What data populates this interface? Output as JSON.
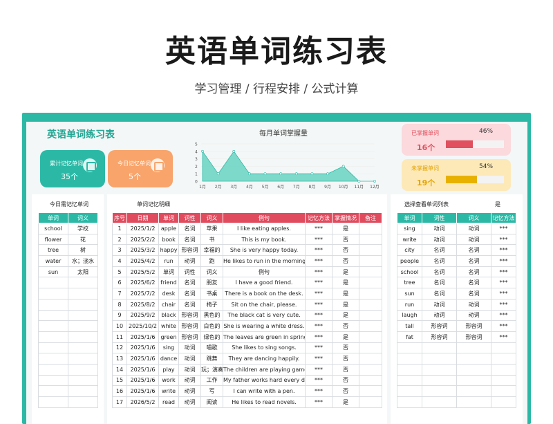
{
  "hero": {
    "title": "英语单词练习表",
    "subtitle": "学习管理 / 行程安排 / 公式计算"
  },
  "app_title": "英语单词练习表",
  "kpis": [
    {
      "label": "累计记忆单词",
      "value": "35个"
    },
    {
      "label": "今日记忆单词",
      "value": "5个"
    }
  ],
  "chart_data": {
    "type": "area",
    "title": "每月单词掌握量",
    "categories": [
      "1月",
      "2月",
      "3月",
      "4月",
      "5月",
      "6月",
      "7月",
      "8月",
      "9月",
      "10月",
      "11月",
      "12月"
    ],
    "values": [
      4,
      1,
      4,
      1,
      1,
      1,
      1,
      1,
      1,
      2,
      0,
      0
    ],
    "yticks": [
      "0",
      "1",
      "2",
      "3",
      "4",
      "5"
    ],
    "ylim": [
      0,
      5
    ],
    "colors": {
      "fill": "#67d4c2",
      "line": "#2bb9a6"
    }
  },
  "stats": [
    {
      "label": "已掌握单词",
      "value": "16个",
      "pct_text": "46%",
      "pct": 46
    },
    {
      "label": "未掌握单词",
      "value": "19个",
      "pct_text": "54%",
      "pct": 54
    }
  ],
  "today": {
    "title": "今日需记忆单词",
    "headers": [
      "单词",
      "词义"
    ],
    "rows": [
      [
        "school",
        "学校"
      ],
      [
        "flower",
        "花"
      ],
      [
        "tree",
        "树"
      ],
      [
        "water",
        "水；浇水"
      ],
      [
        "sun",
        "太阳"
      ],
      [
        "",
        ""
      ],
      [
        "",
        ""
      ],
      [
        "",
        ""
      ],
      [
        "",
        ""
      ],
      [
        "",
        ""
      ],
      [
        "",
        ""
      ],
      [
        "",
        ""
      ],
      [
        "",
        ""
      ],
      [
        "",
        ""
      ],
      [
        "",
        ""
      ],
      [
        "",
        ""
      ],
      [
        "",
        ""
      ]
    ]
  },
  "detail": {
    "title": "单词记忆明细",
    "headers": [
      "序号",
      "日期",
      "单词",
      "词性",
      "词义",
      "例句",
      "记忆方法",
      "掌握情况",
      "备注"
    ],
    "rows": [
      [
        "1",
        "2025/1/2",
        "apple",
        "名词",
        "苹果",
        "I like eating apples.",
        "***",
        "是",
        ""
      ],
      [
        "2",
        "2025/2/2",
        "book",
        "名词",
        "书",
        "This is my book.",
        "***",
        "否",
        ""
      ],
      [
        "3",
        "2025/3/2",
        "happy",
        "形容词",
        "幸福的",
        "She is very happy today.",
        "***",
        "否",
        ""
      ],
      [
        "4",
        "2025/4/2",
        "run",
        "动词",
        "跑",
        "He likes to run in the morning.",
        "***",
        "否",
        ""
      ],
      [
        "5",
        "2025/5/2",
        "单词",
        "词性",
        "词义",
        "例句",
        "***",
        "是",
        ""
      ],
      [
        "6",
        "2025/6/2",
        "friend",
        "名词",
        "朋友",
        "I have a good friend.",
        "***",
        "是",
        ""
      ],
      [
        "7",
        "2025/7/2",
        "desk",
        "名词",
        "书桌",
        "There is a book on the desk.",
        "***",
        "是",
        ""
      ],
      [
        "8",
        "2025/8/2",
        "chair",
        "名词",
        "椅子",
        "Sit on the chair, please.",
        "***",
        "是",
        ""
      ],
      [
        "9",
        "2025/9/2",
        "black",
        "形容词",
        "黑色的",
        "The black cat is very cute.",
        "***",
        "是",
        ""
      ],
      [
        "10",
        "2025/10/2",
        "white",
        "形容词",
        "白色的",
        "She is wearing a white dress.",
        "***",
        "否",
        ""
      ],
      [
        "11",
        "2025/1/6",
        "green",
        "形容词",
        "绿色的",
        "The leaves are green in spring.",
        "***",
        "是",
        ""
      ],
      [
        "12",
        "2025/1/6",
        "sing",
        "动词",
        "唱歌",
        "She likes to sing songs.",
        "***",
        "否",
        ""
      ],
      [
        "13",
        "2025/1/6",
        "dance",
        "动词",
        "跳舞",
        "They are dancing happily.",
        "***",
        "否",
        ""
      ],
      [
        "14",
        "2025/1/6",
        "play",
        "动词",
        "玩；演奏",
        "The children are playing games.",
        "***",
        "否",
        ""
      ],
      [
        "15",
        "2025/1/6",
        "work",
        "动词",
        "工作",
        "My father works hard every day.",
        "***",
        "否",
        ""
      ],
      [
        "16",
        "2025/1/6",
        "write",
        "动词",
        "写",
        "I can write with a pen.",
        "***",
        "否",
        ""
      ],
      [
        "17",
        "2026/5/2",
        "read",
        "动词",
        "阅读",
        "He likes to read novels.",
        "***",
        "是",
        ""
      ]
    ]
  },
  "query": {
    "title": "选择查看单词列表",
    "selected": "是",
    "headers": [
      "单词",
      "词性",
      "词义",
      "记忆方法"
    ],
    "rows": [
      [
        "sing",
        "动词",
        "动词",
        "***"
      ],
      [
        "write",
        "动词",
        "动词",
        "***"
      ],
      [
        "city",
        "名词",
        "名词",
        "***"
      ],
      [
        "people",
        "名词",
        "名词",
        "***"
      ],
      [
        "school",
        "名词",
        "名词",
        "***"
      ],
      [
        "tree",
        "名词",
        "名词",
        "***"
      ],
      [
        "sun",
        "名词",
        "名词",
        "***"
      ],
      [
        "run",
        "动词",
        "动词",
        "***"
      ],
      [
        "laugh",
        "动词",
        "动词",
        "***"
      ],
      [
        "tall",
        "形容词",
        "形容词",
        "***"
      ],
      [
        "fat",
        "形容词",
        "形容词",
        "***"
      ],
      [
        "",
        "",
        "",
        ""
      ],
      [
        "",
        "",
        "",
        ""
      ],
      [
        "",
        "",
        "",
        ""
      ],
      [
        "",
        "",
        "",
        ""
      ],
      [
        "",
        "",
        "",
        ""
      ],
      [
        "",
        "",
        "",
        ""
      ]
    ]
  }
}
